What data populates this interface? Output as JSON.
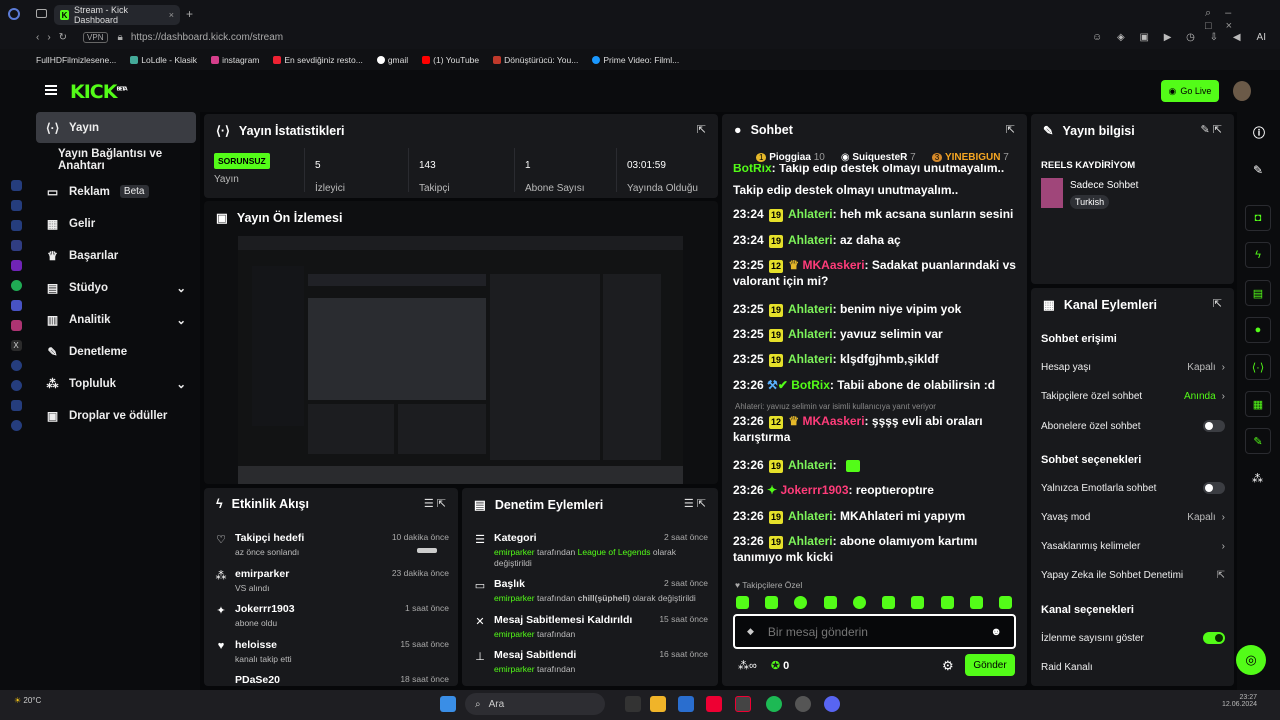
{
  "browser": {
    "tab_title": "Stream - Kick Dashboard",
    "url": "https://dashboard.kick.com/stream",
    "vpn": "VPN",
    "ai": "AI"
  },
  "bookmarks": [
    "FullHDFilmizlesene...",
    "LoLdle - Klasik",
    "instagram",
    "En sevdiğiniz resto...",
    "gmail",
    "(1) YouTube",
    "Dönüştürücü: You...",
    "Prime Video: Filml..."
  ],
  "header": {
    "logo": "KICK",
    "logo_sup": "BETA",
    "go_live": "Go Live"
  },
  "sidebar": {
    "items": [
      {
        "label": "Yayın",
        "icon": "signal-icon"
      },
      {
        "label": "Yayın Bağlantısı ve Anahtarı"
      },
      {
        "label": "Reklam",
        "badge": "Beta"
      },
      {
        "label": "Gelir"
      },
      {
        "label": "Başarılar"
      },
      {
        "label": "Stüdyo"
      },
      {
        "label": "Analitik"
      },
      {
        "label": "Denetleme"
      },
      {
        "label": "Topluluk"
      },
      {
        "label": "Droplar ve ödüller"
      }
    ]
  },
  "stats": {
    "title": "Yayın İstatistikleri",
    "status": "SORUNSUZ",
    "status_label": "Yayın",
    "viewers": "5",
    "viewers_label": "İzleyici",
    "followers": "143",
    "followers_label": "Takipçi",
    "subs": "1",
    "subs_label": "Abone Sayısı",
    "uptime": "03:01:59",
    "uptime_label": "Yayında Olduğu"
  },
  "preview": {
    "title": "Yayın Ön İzlemesi"
  },
  "activity": {
    "title": "Etkinlik Akışı",
    "items": [
      {
        "title": "Takipçi hedefi",
        "sub": "az önce sonlandı",
        "time": "10 dakika önce"
      },
      {
        "title": "emirparker",
        "sub": "VS alındı",
        "time": "23 dakika önce"
      },
      {
        "title": "Jokerrr1903",
        "sub": "abone oldu",
        "time": "1 saat önce"
      },
      {
        "title": "heloisse",
        "sub": "kanalı takip etti",
        "time": "15 saat önce"
      },
      {
        "title": "PDaSe20",
        "sub": "",
        "time": "18 saat önce"
      }
    ]
  },
  "moderation": {
    "title": "Denetim Eylemleri",
    "items": [
      {
        "title": "Kategori",
        "user": "emirparker",
        "mid": "tarafından",
        "target": "League of Legends",
        "tail": "olarak değiştirildi",
        "time": "2 saat önce"
      },
      {
        "title": "Başlık",
        "user": "emirparker",
        "mid": "tarafından",
        "target": "chill(şüpheli)",
        "tail": "olarak değiştirildi",
        "time": "2 saat önce"
      },
      {
        "title": "Mesaj Sabitlemesi Kaldırıldı",
        "user": "emirparker",
        "mid": "tarafından",
        "target": "",
        "tail": "",
        "time": "15 saat önce"
      },
      {
        "title": "Mesaj Sabitlendi",
        "user": "emirparker",
        "mid": "tarafından",
        "target": "",
        "tail": "",
        "time": "16 saat önce"
      }
    ]
  },
  "chat": {
    "title": "Sohbet",
    "top": [
      {
        "rank": "1",
        "name": "Pioggiaa",
        "pts": "10"
      },
      {
        "rank": "",
        "name": "SuiquesteR",
        "pts": "7"
      },
      {
        "rank": "3",
        "name": "YINEBIGUN",
        "pts": "7"
      }
    ],
    "lines": [
      {
        "time": "",
        "user": "BotRix",
        "msg": "Takip edip destek olmayı unutmayalım..",
        "badge": ""
      },
      {
        "time": "23:24",
        "user": "Ahlateri",
        "msg": "heh mk acsana sunların sesini",
        "badge": "19"
      },
      {
        "time": "23:24",
        "user": "Ahlateri",
        "msg": "az daha aç",
        "badge": "19"
      },
      {
        "time": "23:25",
        "user": "MKAaskeri",
        "msg": "Sadakat puanlarındaki vs valorant için mi?",
        "badge": "12"
      },
      {
        "time": "23:25",
        "user": "Ahlateri",
        "msg": "benim niye vipim yok",
        "badge": "19"
      },
      {
        "time": "23:25",
        "user": "Ahlateri",
        "msg": "yavıuz selimin var",
        "badge": "19"
      },
      {
        "time": "23:25",
        "user": "Ahlateri",
        "msg": "klşdfgjhmb,şikldf",
        "badge": "19"
      },
      {
        "time": "23:26",
        "user": "BotRix",
        "msg": "Tabii abone de olabilirsin :d",
        "badge": ""
      },
      {
        "time": "23:26",
        "user": "MKAaskeri",
        "msg": "şşşş evli abi oraları karıştırma",
        "badge": "12"
      },
      {
        "time": "23:26",
        "user": "Ahlateri",
        "msg": "",
        "badge": "19"
      },
      {
        "time": "23:26",
        "user": "Jokerrr1903",
        "msg": "reoptıeroptıre",
        "badge": ""
      },
      {
        "time": "23:26",
        "user": "Ahlateri",
        "msg": "MKAhlateri mi yapıym",
        "badge": "19"
      },
      {
        "time": "23:26",
        "user": "Ahlateri",
        "msg": "abone olamıyom kartımı tanımıyo mk kicki",
        "badge": "19"
      }
    ],
    "reply_note": "Ahlateri: yavıuz selimin var isimli kullanıcıya yanıt veriyor",
    "followers_only": "Takipçilere Özel",
    "placeholder": "Bir mesaj gönderin",
    "send": "Gönder",
    "points": "0"
  },
  "info": {
    "title": "Yayın bilgisi",
    "category": "REELS KAYDİRİYOM",
    "sub": "Sadece Sohbet",
    "lang": "Turkish"
  },
  "channel": {
    "title": "Kanal Eylemleri",
    "chat_access": "Sohbet erişimi",
    "account_age": "Hesap yaşı",
    "account_age_val": "Kapalı",
    "followers_chat": "Takipçilere özel sohbet",
    "followers_chat_val": "Anında",
    "subs_chat": "Abonelere özel sohbet",
    "chat_options": "Sohbet seçenekleri",
    "emote_only": "Yalnızca Emotlarla sohbet",
    "slow": "Yavaş mod",
    "slow_val": "Kapalı",
    "banned_words": "Yasaklanmış kelimeler",
    "ai_mod": "Yapay Zeka ile Sohbet Denetimi",
    "channel_options": "Kanal seçenekleri",
    "show_views": "İzlenme sayısını göster",
    "raid": "Raid Kanalı"
  },
  "taskbar": {
    "search": "Ara",
    "temp": "20°C",
    "time": "23:27",
    "date": "12.06.2024"
  }
}
